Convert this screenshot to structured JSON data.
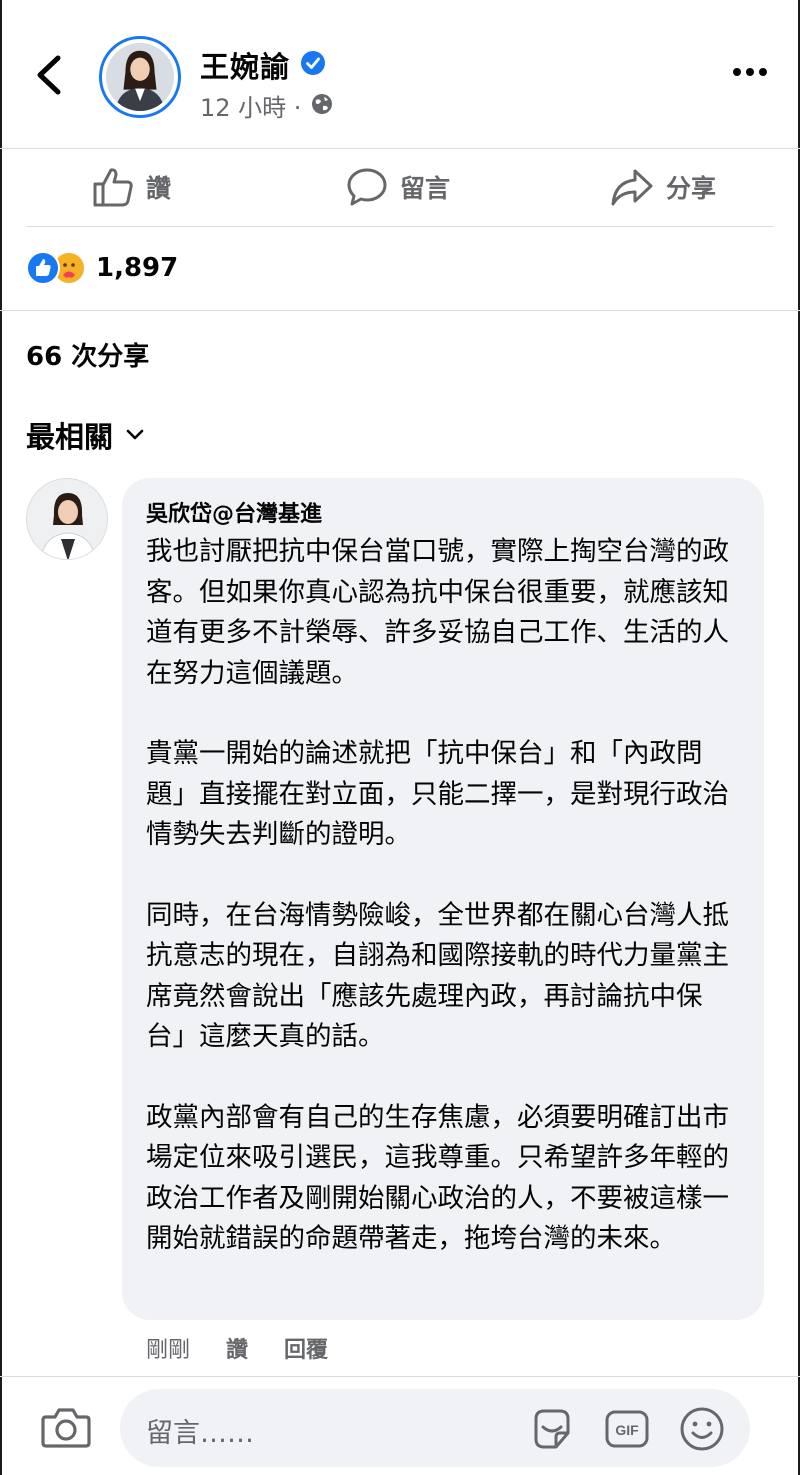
{
  "header": {
    "poster_name": "王婉諭",
    "post_time": "12 小時 ·",
    "icons": {
      "back": "chevron-left-icon",
      "verified": "verified-badge-icon",
      "globe": "globe-icon",
      "more": "more-icon"
    }
  },
  "action_bar": {
    "like": "讚",
    "comment": "留言",
    "share": "分享"
  },
  "reactions": {
    "count": "1,897",
    "types": [
      "like",
      "care"
    ]
  },
  "shares": "66 次分享",
  "sort": {
    "label": "最相關"
  },
  "comment": {
    "author": "吳欣岱@台灣基進",
    "paragraphs": [
      "我也討厭把抗中保台當口號，實際上掏空台灣的政客。但如果你真心認為抗中保台很重要，就應該知道有更多不計榮辱、許多妥協自己工作、生活的人在努力這個議題。",
      "貴黨一開始的論述就把「抗中保台」和「內政問題」直接擺在對立面，只能二擇一，是對現行政治情勢失去判斷的證明。",
      "同時，在台海情勢險峻，全世界都在關心台灣人抵抗意志的現在，自詡為和國際接軌的時代力量黨主席竟然會說出「應該先處理內政，再討論抗中保台」這麼天真的話。",
      "政黨內部會有自己的生存焦慮，必須要明確訂出市場定位來吸引選民，這我尊重。只希望許多年輕的政治工作者及剛開始關心政治的人，不要被這樣一開始就錯誤的命題帶著走，拖垮台灣的未來。"
    ],
    "time": "剛剛",
    "like": "讚",
    "reply": "回覆"
  },
  "composer": {
    "placeholder": "留言……",
    "icons": [
      "camera-icon",
      "sticker-icon",
      "gif-icon",
      "emoji-icon"
    ]
  },
  "colors": {
    "accent": "#1877f2",
    "muted": "#65676b",
    "bubble": "#f0f2f5"
  }
}
